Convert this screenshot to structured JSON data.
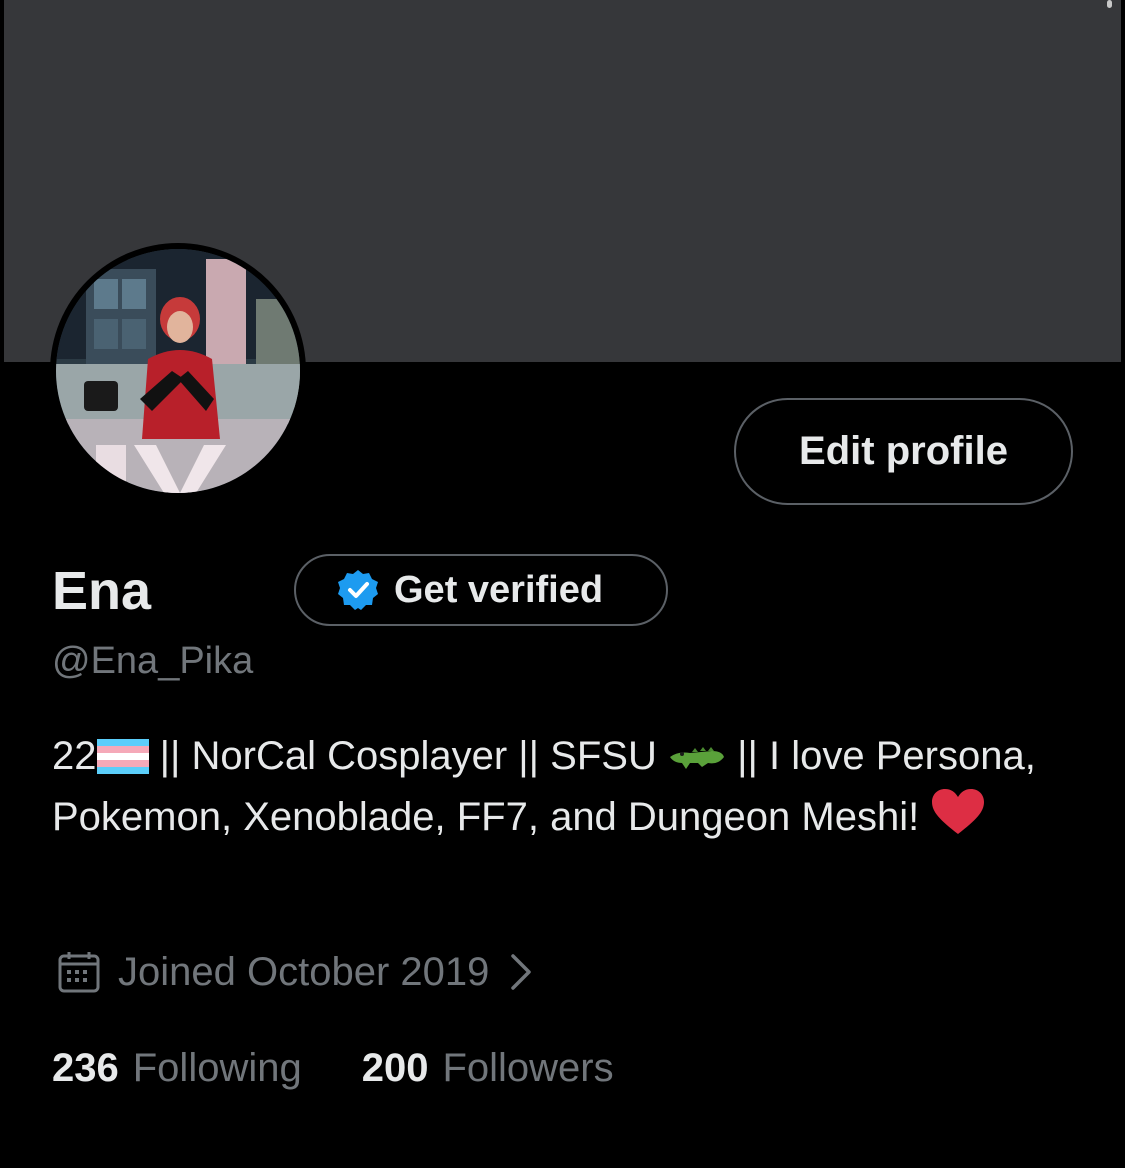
{
  "profile": {
    "display_name": "Ena",
    "handle": "@Ena_Pika",
    "edit_button_label": "Edit profile",
    "verify_button_label": "Get verified",
    "bio": {
      "age": "22",
      "segment_1": " || NorCal Cosplayer || SFSU ",
      "segment_2": " || I love Persona, Pokemon, Xenoblade, FF7, and Dungeon Meshi! "
    },
    "joined_text": "Joined October 2019",
    "stats": {
      "following_count": "236",
      "following_label": "Following",
      "followers_count": "200",
      "followers_label": "Followers"
    }
  },
  "icons": {
    "verified_badge": "verified-badge-icon",
    "calendar": "calendar-icon",
    "chevron": "chevron-right-icon",
    "trans_flag": "transgender-flag-emoji",
    "crocodile": "crocodile-emoji",
    "heart": "red-heart-emoji"
  },
  "colors": {
    "background": "#000000",
    "banner": "#36373a",
    "primary_text": "#e7e9ea",
    "secondary_text": "#71767b",
    "button_border": "#5b6066",
    "verified_blue": "#1d9bf0",
    "heart_red": "#dd2e44"
  }
}
